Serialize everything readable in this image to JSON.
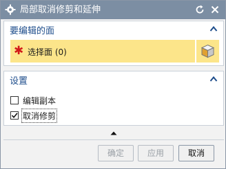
{
  "window": {
    "title": "局部取消修剪和延伸"
  },
  "group_required": {
    "header": "要编辑的面",
    "select_label": "选择面 (0)",
    "required_marker": "✱"
  },
  "group_settings": {
    "header": "设置",
    "options": [
      {
        "label": "编辑副本",
        "checked": false
      },
      {
        "label": "取消修剪",
        "checked": true
      }
    ]
  },
  "buttons": {
    "ok": "确定",
    "apply": "应用",
    "cancel": "取消"
  },
  "colors": {
    "titlebar": "#7c8ea3",
    "selection_highlight": "#fce58a",
    "group_header_text": "#1f4e8c"
  },
  "icons": {
    "app": "gear-icon",
    "reset": "reset-icon",
    "close": "close-icon",
    "collapse": "chevron-up-icon",
    "face": "cube-icon",
    "more": "triangle-up-icon"
  }
}
